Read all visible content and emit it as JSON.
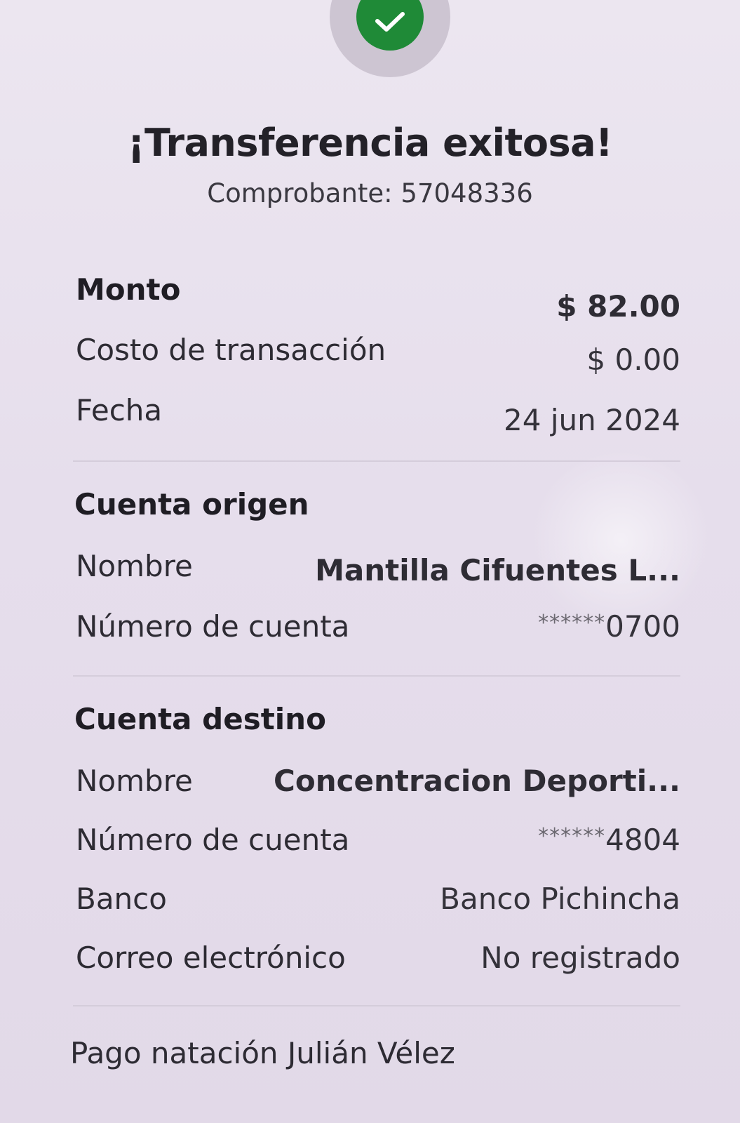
{
  "header": {
    "success_icon": "check-icon",
    "title": "¡Transferencia exitosa!",
    "receipt_label": "Comprobante:",
    "receipt_number": "57048336"
  },
  "summary": {
    "amount_label": "Monto",
    "amount_value": "$ 82.00",
    "fee_label": "Costo de transacción",
    "fee_value": "$ 0.00",
    "date_label": "Fecha",
    "date_value": "24 jun 2024"
  },
  "origin": {
    "section_title": "Cuenta origen",
    "name_label": "Nombre",
    "name_value": "Mantilla  Cifuentes L...",
    "account_label": "Número de cuenta",
    "account_mask": "******",
    "account_last": "0700"
  },
  "destination": {
    "section_title": "Cuenta destino",
    "name_label": "Nombre",
    "name_value": "Concentracion Deporti...",
    "account_label": "Número de cuenta",
    "account_mask": "******",
    "account_last": "4804",
    "bank_label": "Banco",
    "bank_value": "Banco Pichincha",
    "email_label": "Correo electrónico",
    "email_value": "No registrado"
  },
  "note": "Pago natación Julián Vélez",
  "colors": {
    "success_green": "#1f8a37",
    "background": "#e7e0ec"
  }
}
